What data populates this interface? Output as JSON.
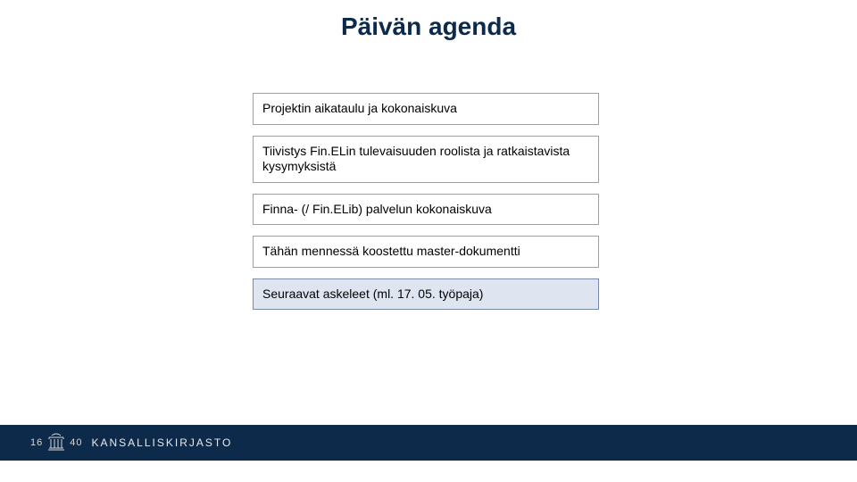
{
  "slide": {
    "title": "Päivän agenda",
    "agenda_items": [
      {
        "text": "Projektin aikataulu ja kokonaiskuva",
        "highlight": false
      },
      {
        "text": "Tiivistys Fin.ELin tulevaisuuden roolista ja ratkaistavista kysymyksistä",
        "highlight": false
      },
      {
        "text": "Finna- (/ Fin.ELib) palvelun kokonaiskuva",
        "highlight": false
      },
      {
        "text": "Tähän mennessä koostettu master-dokumentti",
        "highlight": false
      },
      {
        "text": "Seuraavat askeleet (ml. 17. 05. työpaja)",
        "highlight": true
      }
    ]
  },
  "footer": {
    "year_left": "16",
    "year_right": "40",
    "brand": "KANSALLISKIRJASTO"
  }
}
